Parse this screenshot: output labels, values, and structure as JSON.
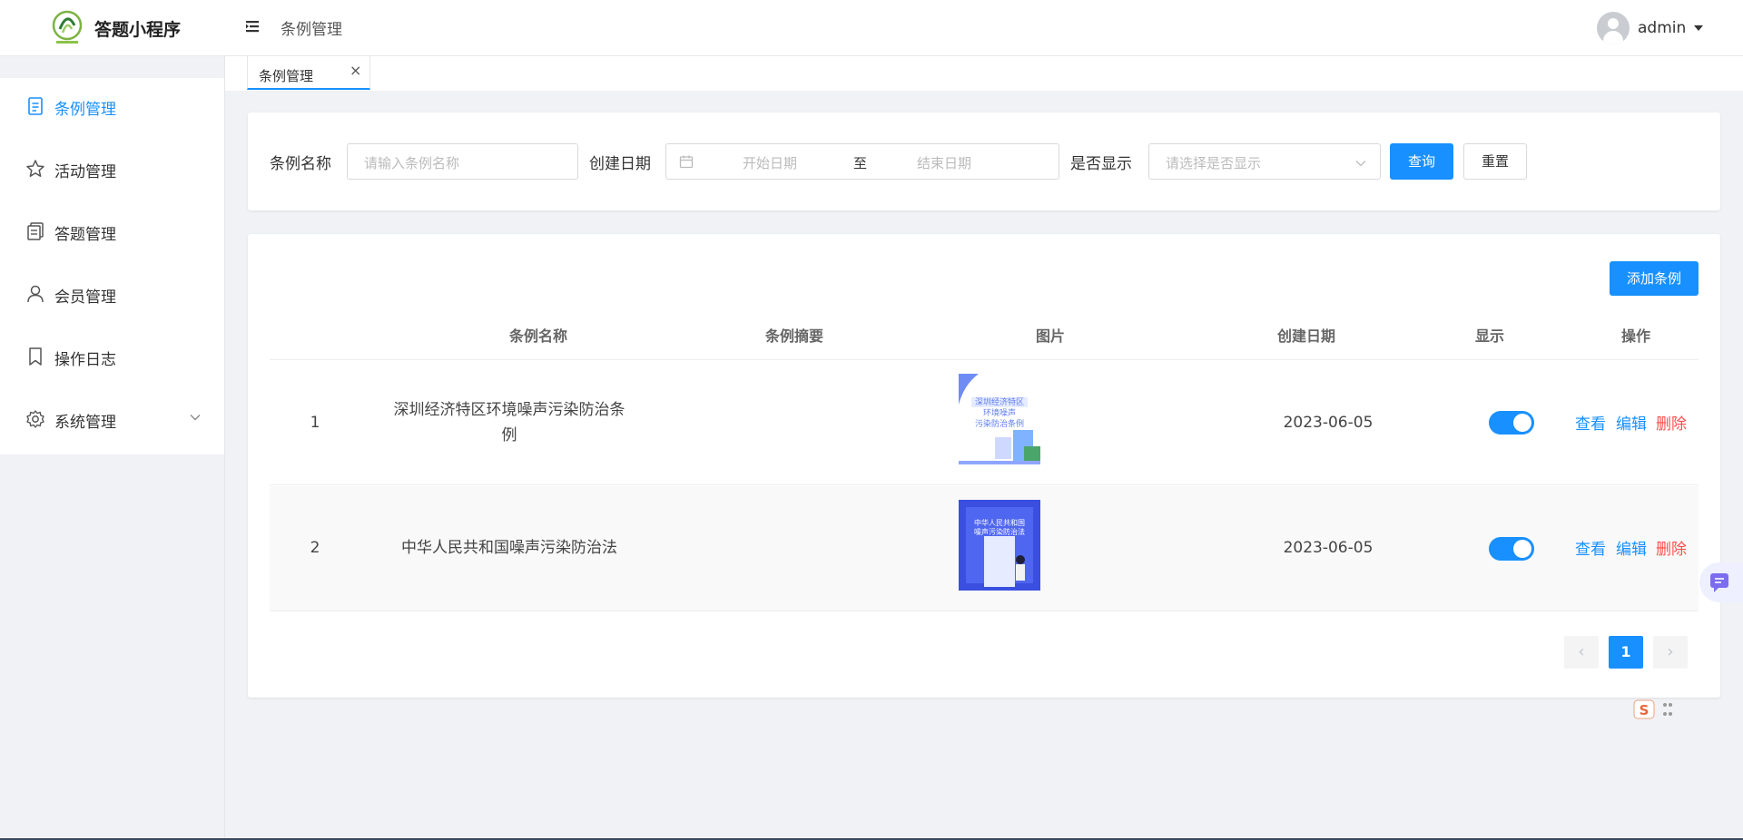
{
  "header": {
    "app_name": "答题小程序",
    "page_title": "条例管理",
    "user": "admin"
  },
  "tabs": [
    {
      "label": "条例管理",
      "close": "×"
    }
  ],
  "sidebar": {
    "items": [
      {
        "label": "条例管理",
        "icon": "document-icon",
        "active": true
      },
      {
        "label": "活动管理",
        "icon": "star-icon"
      },
      {
        "label": "答题管理",
        "icon": "copy-icon"
      },
      {
        "label": "会员管理",
        "icon": "user-icon"
      },
      {
        "label": "操作日志",
        "icon": "bookmark-icon"
      },
      {
        "label": "系统管理",
        "icon": "gear-icon",
        "expandable": true
      }
    ]
  },
  "filter": {
    "name_label": "条例名称",
    "name_placeholder": "请输入条例名称",
    "date_label": "创建日期",
    "date_start_placeholder": "开始日期",
    "date_separator": "至",
    "date_end_placeholder": "结束日期",
    "display_label": "是否显示",
    "display_placeholder": "请选择是否显示",
    "search_button": "查询",
    "reset_button": "重置"
  },
  "table": {
    "add_button": "添加条例",
    "columns": [
      "条例名称",
      "条例摘要",
      "图片",
      "创建日期",
      "显示",
      "操作"
    ],
    "rows": [
      {
        "index": "1",
        "name": "深圳经济特区环境噪声污染防治条例",
        "summary": "",
        "image_alt": "深圳经济特区环境噪声污染防治条例",
        "date": "2023-06-05",
        "visible": true,
        "actions": {
          "view": "查看",
          "edit": "编辑",
          "delete": "删除"
        }
      },
      {
        "index": "2",
        "name": "中华人民共和国噪声污染防治法",
        "summary": "",
        "image_alt": "中华人民共和国噪声污染防治法",
        "date": "2023-06-05",
        "visible": true,
        "actions": {
          "view": "查看",
          "edit": "编辑",
          "delete": "删除"
        }
      }
    ]
  },
  "pagination": {
    "prev": "‹",
    "current": "1",
    "next": "›"
  },
  "colors": {
    "primary": "#1890ff",
    "danger": "#ff4d4f",
    "sidebar_bg": "#ffffff",
    "page_bg": "#f0f2f5"
  }
}
